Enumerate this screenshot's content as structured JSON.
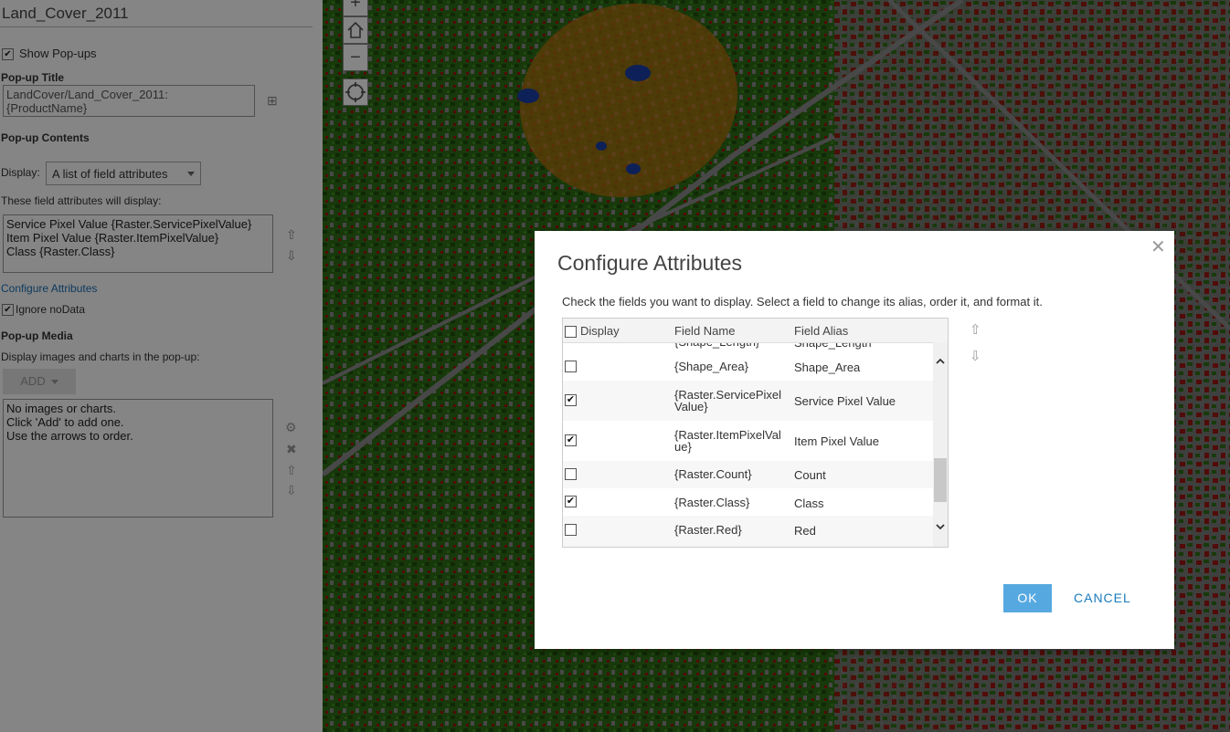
{
  "panel": {
    "layer_title": "Land_Cover_2011",
    "show_popups_label": "Show Pop-ups",
    "show_popups_checked": true,
    "popup_title_heading": "Pop-up Title",
    "popup_title_value": "LandCover/Land_Cover_2011: {ProductName}",
    "popup_contents_heading": "Pop-up Contents",
    "display_label": "Display:",
    "display_value": "A list of field attributes",
    "field_attrs_label": "These field attributes will display:",
    "field_attrs": [
      "Service Pixel Value {Raster.ServicePixelValue}",
      "Item Pixel Value {Raster.ItemPixelValue}",
      "Class {Raster.Class}"
    ],
    "configure_link": "Configure Attributes",
    "ignore_nodata_label": "Ignore noData",
    "ignore_nodata_checked": true,
    "popup_media_heading": "Pop-up Media",
    "media_label": "Display images and charts in the pop-up:",
    "add_button": "ADD",
    "media_text": [
      "No images or charts.",
      "Click 'Add' to add one.",
      "Use the arrows to order."
    ]
  },
  "map": {
    "colors": {
      "vegetation": "#2f6d16",
      "forest": "#1f4f0c",
      "developed": "#8a8a8a",
      "buildings": "#a31212",
      "bare": "#b7720f",
      "water": "#1a3fa8"
    }
  },
  "dialog": {
    "title": "Configure Attributes",
    "instructions": "Check the fields you want to display. Select a field to change its alias, order it, and format it.",
    "columns": {
      "display": "Display",
      "field_name": "Field Name",
      "field_alias": "Field Alias"
    },
    "partial_row": {
      "name": "{Shape_Length}",
      "alias": "Shape_Length"
    },
    "rows": [
      {
        "name": "{Shape_Area}",
        "alias": "Shape_Area",
        "checked": false
      },
      {
        "name_line1": "{Raster.ServicePixel",
        "name_line2": "Value}",
        "alias": "Service Pixel Value",
        "checked": true
      },
      {
        "name_line1": "{Raster.ItemPixelVal",
        "name_line2": "ue}",
        "alias": "Item Pixel Value",
        "checked": true
      },
      {
        "name": "{Raster.Count}",
        "alias": "Count",
        "checked": false
      },
      {
        "name": "{Raster.Class}",
        "alias": "Class",
        "checked": true
      },
      {
        "name": "{Raster.Red}",
        "alias": "Red",
        "checked": false
      }
    ],
    "ok_button": "OK",
    "cancel_button": "CANCEL"
  }
}
